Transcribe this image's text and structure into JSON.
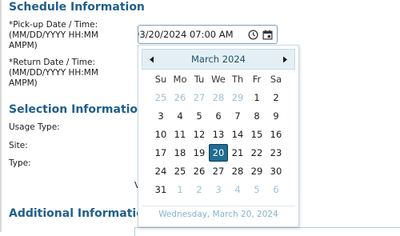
{
  "sections": {
    "schedule": "Schedule Information",
    "selection": "Selection Information",
    "additional": "Additional Information"
  },
  "labels": {
    "pickup": "*Pick-up Date / Time:\n(MM/DD/YYYY HH:MM\nAMPM)",
    "return": "*Return Date / Time:\n(MM/DD/YYYY HH:MM\nAMPM)",
    "usage_type": "Usage Type:",
    "site": "Site:",
    "type": "Type:"
  },
  "pickup_input": {
    "value": "03/20/2024 07:00 AM",
    "clock_icon": "clock-icon",
    "calendar_icon": "calendar-icon"
  },
  "calendar": {
    "month_label": "March 2024",
    "prev_icon": "triangle-left-icon",
    "next_icon": "triangle-right-icon",
    "weekdays": [
      "Su",
      "Mo",
      "Tu",
      "We",
      "Th",
      "Fr",
      "Sa"
    ],
    "weeks": [
      [
        {
          "d": "25",
          "o": true
        },
        {
          "d": "26",
          "o": true
        },
        {
          "d": "27",
          "o": true
        },
        {
          "d": "28",
          "o": true
        },
        {
          "d": "29",
          "o": true
        },
        {
          "d": "1"
        },
        {
          "d": "2"
        }
      ],
      [
        {
          "d": "3"
        },
        {
          "d": "4"
        },
        {
          "d": "5"
        },
        {
          "d": "6"
        },
        {
          "d": "7"
        },
        {
          "d": "8"
        },
        {
          "d": "9"
        }
      ],
      [
        {
          "d": "10"
        },
        {
          "d": "11"
        },
        {
          "d": "12"
        },
        {
          "d": "13"
        },
        {
          "d": "14"
        },
        {
          "d": "15"
        },
        {
          "d": "16"
        }
      ],
      [
        {
          "d": "17"
        },
        {
          "d": "18"
        },
        {
          "d": "19"
        },
        {
          "d": "20",
          "s": true
        },
        {
          "d": "21"
        },
        {
          "d": "22"
        },
        {
          "d": "23"
        }
      ],
      [
        {
          "d": "24"
        },
        {
          "d": "25"
        },
        {
          "d": "26"
        },
        {
          "d": "27"
        },
        {
          "d": "28"
        },
        {
          "d": "29"
        },
        {
          "d": "30"
        }
      ],
      [
        {
          "d": "31"
        },
        {
          "d": "1",
          "o": true
        },
        {
          "d": "2",
          "o": true
        },
        {
          "d": "3",
          "o": true
        },
        {
          "d": "4",
          "o": true
        },
        {
          "d": "5",
          "o": true
        },
        {
          "d": "6",
          "o": true
        }
      ]
    ],
    "footer": "Wednesday, March 20, 2024"
  },
  "stray_text": "V",
  "colors": {
    "heading": "#1f5f8b",
    "selected_day": "#1f6d93",
    "other_month_day": "#9fbfd0",
    "header_bg": "#e4eff5"
  }
}
